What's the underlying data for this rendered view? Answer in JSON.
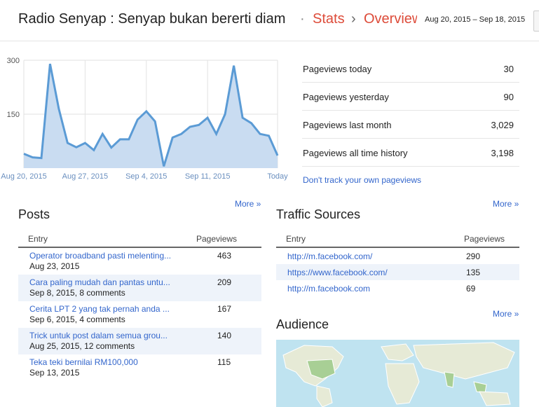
{
  "header": {
    "blog_title": "Radio Senyap : Senyap bukan bererti diam",
    "separator": "·",
    "crumb_stats": "Stats",
    "crumb_arrow": "›",
    "crumb_overview": "Overview",
    "date_range": "Aug 20, 2015 – Sep 18, 2015"
  },
  "chart_data": {
    "type": "area",
    "x_tick_labels": [
      "Aug 20, 2015",
      "Aug 27, 2015",
      "Sep 4, 2015",
      "Sep 11, 2015",
      "Today"
    ],
    "y_tick_labels": [
      "300",
      "150"
    ],
    "ylim": [
      0,
      300
    ],
    "values": [
      40,
      30,
      28,
      290,
      165,
      70,
      58,
      70,
      50,
      95,
      57,
      80,
      80,
      135,
      158,
      130,
      5,
      85,
      95,
      115,
      120,
      140,
      95,
      150,
      285,
      140,
      125,
      95,
      90,
      35
    ],
    "fill_color": "#c9dcf1",
    "line_color": "#5b9bd5"
  },
  "stats": [
    {
      "label": "Pageviews today",
      "value": "30"
    },
    {
      "label": "Pageviews yesterday",
      "value": "90"
    },
    {
      "label": "Pageviews last month",
      "value": "3,029"
    },
    {
      "label": "Pageviews all time history",
      "value": "3,198"
    }
  ],
  "dont_track": "Don't track your own pageviews",
  "posts": {
    "more": "More »",
    "title": "Posts",
    "col_entry": "Entry",
    "col_pageviews": "Pageviews",
    "rows": [
      {
        "title": "Operator broadband pasti melenting...",
        "sub": "Aug 23, 2015",
        "count": "463"
      },
      {
        "title": "Cara paling mudah dan pantas untu...",
        "sub": "Sep 8, 2015, 8 comments",
        "count": "209"
      },
      {
        "title": "Cerita LPT 2 yang tak pernah anda ...",
        "sub": "Sep 6, 2015, 4 comments",
        "count": "167"
      },
      {
        "title": "Trick untuk post dalam semua grou...",
        "sub": "Aug 25, 2015, 12 comments",
        "count": "140"
      },
      {
        "title": "Teka teki bernilai RM100,000",
        "sub": "Sep 13, 2015",
        "count": "115"
      }
    ]
  },
  "traffic": {
    "more": "More »",
    "title": "Traffic Sources",
    "col_entry": "Entry",
    "col_pageviews": "Pageviews",
    "rows": [
      {
        "entry": "http://m.facebook.com/",
        "count": "290"
      },
      {
        "entry": "https://www.facebook.com/",
        "count": "135"
      },
      {
        "entry": "http://m.facebook.com",
        "count": "69"
      }
    ]
  },
  "audience": {
    "more": "More »",
    "title": "Audience"
  }
}
